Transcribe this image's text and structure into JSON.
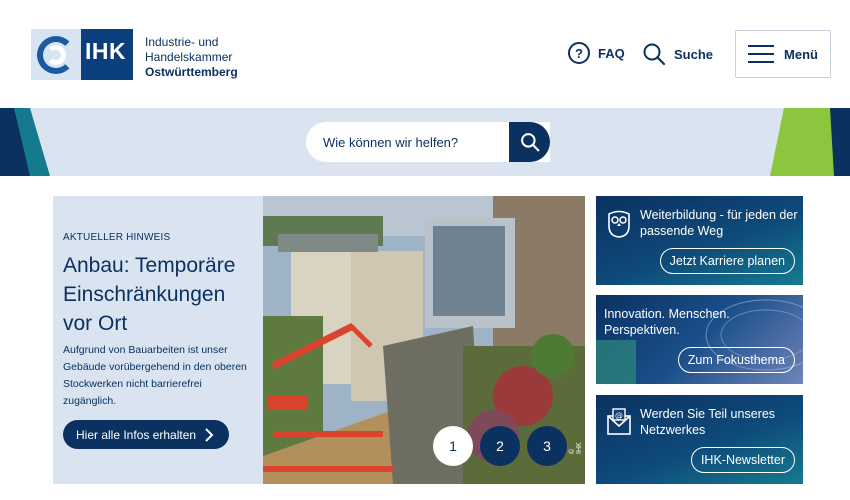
{
  "header": {
    "logo_text": "IHK",
    "org_line1": "Industrie- und",
    "org_line2": "Handelskammer",
    "org_line3": "Ostwürttemberg",
    "faq_label": "FAQ",
    "search_label": "Suche",
    "menu_label": "Menü"
  },
  "search": {
    "placeholder": "Wie können wir helfen?"
  },
  "hero": {
    "kicker": "AKTUELLER HINWEIS",
    "title": "Anbau: Temporäre Einschränkungen vor Ort",
    "body": "Aufgrund von Bauarbeiten ist unser Gebäude vorübergehend in den oberen Stockwerken nicht barrierefrei zugänglich.",
    "cta_label": "Hier alle Infos erhalten",
    "photo_credit": "© IHK",
    "pager": [
      "1",
      "2",
      "3"
    ]
  },
  "teasers": [
    {
      "title": "Weiterbildung - für jeden der passende Weg",
      "button": "Jetzt Karriere planen",
      "icon": "owl-icon"
    },
    {
      "title": "Innovation. Menschen. Perspektiven.",
      "button": "Zum Fokusthema",
      "icon": ""
    },
    {
      "title": "Werden Sie Teil unseres Netzwerkes",
      "button": "IHK-Newsletter",
      "icon": "newsletter-icon"
    }
  ],
  "colors": {
    "brand_navy": "#0b3161",
    "band_bg": "#dae4f0",
    "accent_green": "#8cc63f",
    "accent_teal": "#167a8e"
  }
}
